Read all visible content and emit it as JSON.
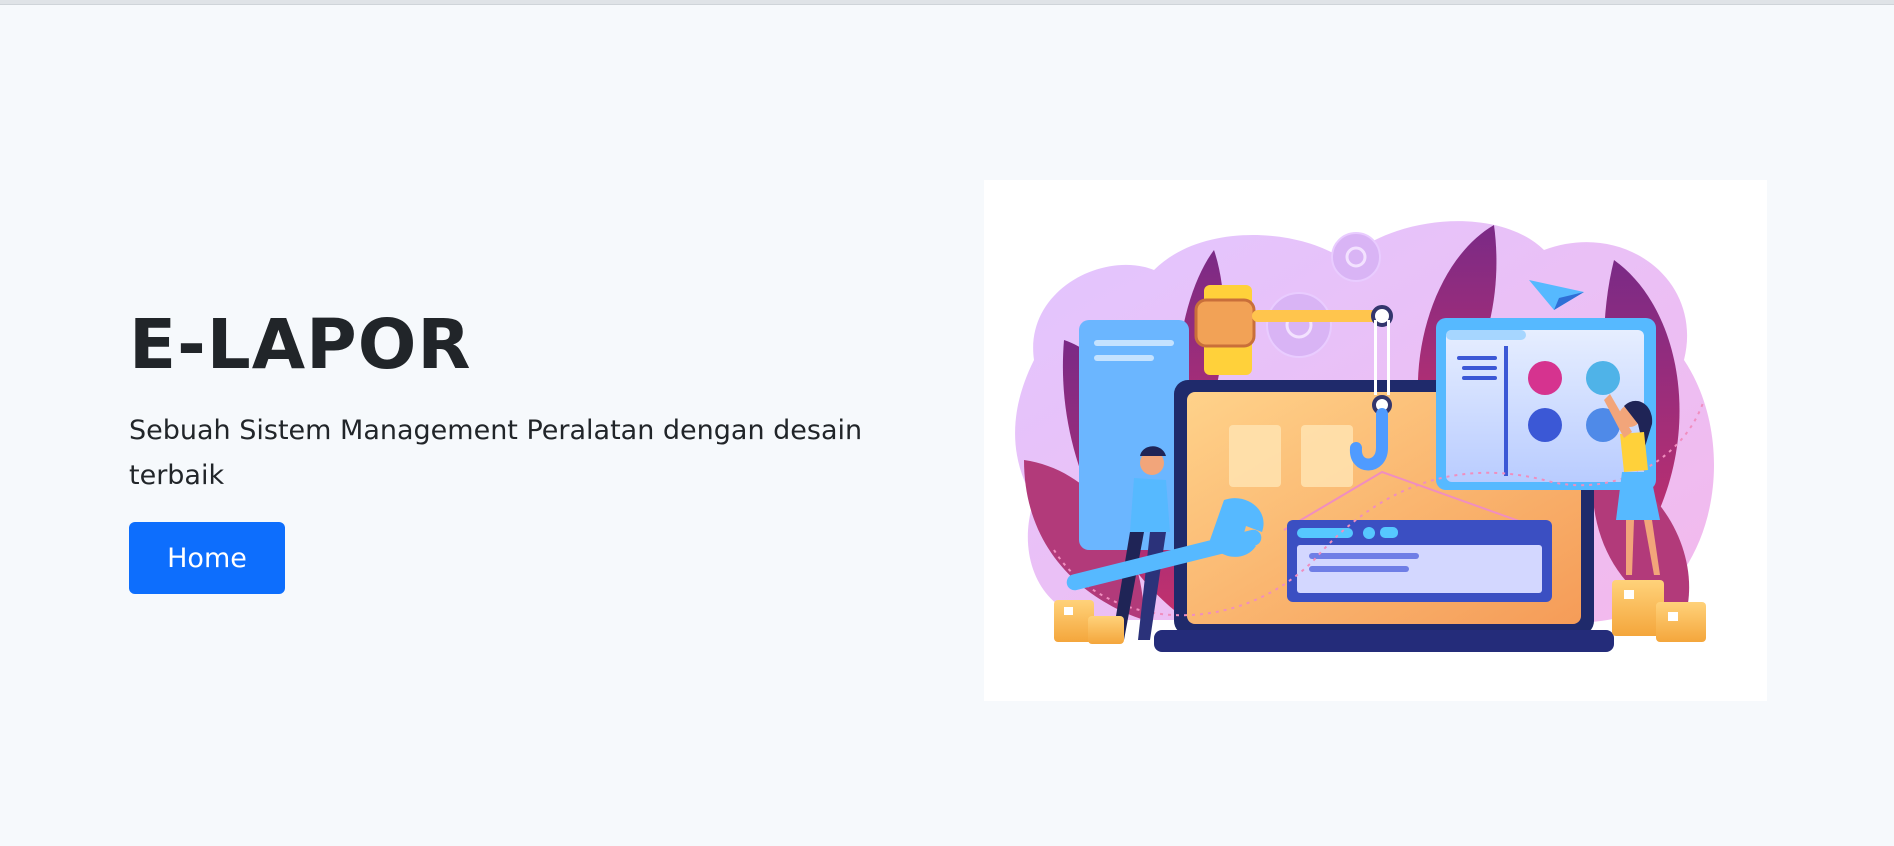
{
  "hero": {
    "title": "E-LAPOR",
    "subtitle": "Sebuah Sistem Management Peralatan dengan desain terbaik",
    "button_label": "Home"
  },
  "illustration": {
    "icon": "maintenance-illustration"
  },
  "colors": {
    "page_background": "#f6f9fc",
    "accent": "#0d6efd",
    "text": "#212529"
  }
}
